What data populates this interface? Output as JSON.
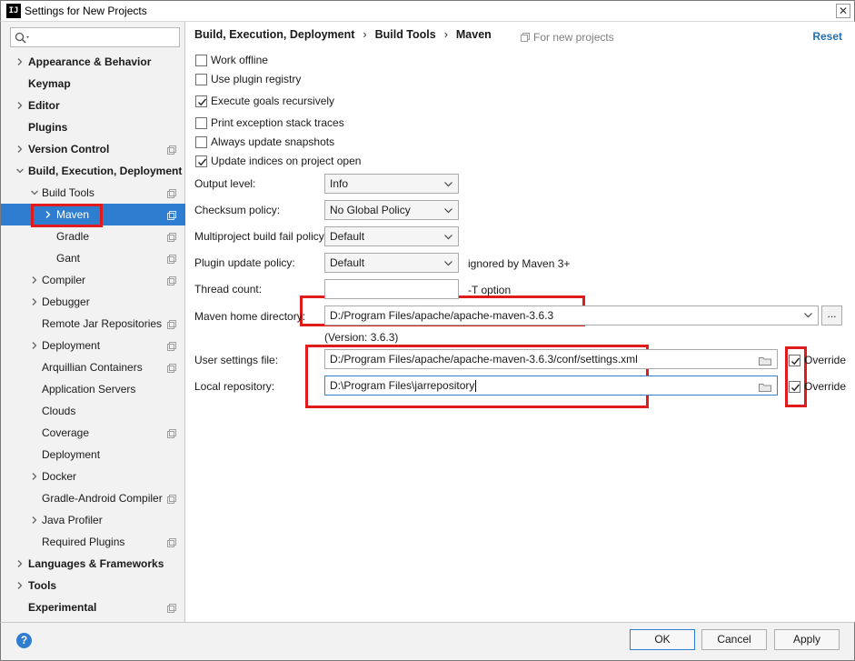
{
  "window": {
    "title": "Settings for New Projects",
    "logo": "IJ",
    "close_glyph": "✕"
  },
  "search": {
    "placeholder": "",
    "value": ""
  },
  "sidebar": {
    "items": [
      {
        "label": "Appearance & Behavior",
        "bold": true,
        "arrow": "right",
        "level": 0,
        "cfg": false
      },
      {
        "label": "Keymap",
        "bold": true,
        "arrow": "none",
        "level": 0,
        "cfg": false
      },
      {
        "label": "Editor",
        "bold": true,
        "arrow": "right",
        "level": 0,
        "cfg": false
      },
      {
        "label": "Plugins",
        "bold": true,
        "arrow": "none",
        "level": 0,
        "cfg": false
      },
      {
        "label": "Version Control",
        "bold": true,
        "arrow": "right",
        "level": 0,
        "cfg": true
      },
      {
        "label": "Build, Execution, Deployment",
        "bold": true,
        "arrow": "down",
        "level": 0,
        "cfg": false
      },
      {
        "label": "Build Tools",
        "bold": false,
        "arrow": "down",
        "level": 1,
        "cfg": true
      },
      {
        "label": "Maven",
        "bold": false,
        "arrow": "right",
        "level": 2,
        "cfg": true,
        "selected": true
      },
      {
        "label": "Gradle",
        "bold": false,
        "arrow": "none",
        "level": 2,
        "cfg": true
      },
      {
        "label": "Gant",
        "bold": false,
        "arrow": "none",
        "level": 2,
        "cfg": true
      },
      {
        "label": "Compiler",
        "bold": false,
        "arrow": "right",
        "level": 1,
        "cfg": true
      },
      {
        "label": "Debugger",
        "bold": false,
        "arrow": "right",
        "level": 1,
        "cfg": false
      },
      {
        "label": "Remote Jar Repositories",
        "bold": false,
        "arrow": "none",
        "level": 1,
        "cfg": true
      },
      {
        "label": "Deployment",
        "bold": false,
        "arrow": "right",
        "level": 1,
        "cfg": true
      },
      {
        "label": "Arquillian Containers",
        "bold": false,
        "arrow": "none",
        "level": 1,
        "cfg": true
      },
      {
        "label": "Application Servers",
        "bold": false,
        "arrow": "none",
        "level": 1,
        "cfg": false
      },
      {
        "label": "Clouds",
        "bold": false,
        "arrow": "none",
        "level": 1,
        "cfg": false
      },
      {
        "label": "Coverage",
        "bold": false,
        "arrow": "none",
        "level": 1,
        "cfg": true
      },
      {
        "label": "Deployment",
        "bold": false,
        "arrow": "none",
        "level": 1,
        "cfg": false
      },
      {
        "label": "Docker",
        "bold": false,
        "arrow": "right",
        "level": 1,
        "cfg": false
      },
      {
        "label": "Gradle-Android Compiler",
        "bold": false,
        "arrow": "none",
        "level": 1,
        "cfg": true
      },
      {
        "label": "Java Profiler",
        "bold": false,
        "arrow": "right",
        "level": 1,
        "cfg": false
      },
      {
        "label": "Required Plugins",
        "bold": false,
        "arrow": "none",
        "level": 1,
        "cfg": true
      },
      {
        "label": "Languages & Frameworks",
        "bold": true,
        "arrow": "right",
        "level": 0,
        "cfg": false
      },
      {
        "label": "Tools",
        "bold": true,
        "arrow": "right",
        "level": 0,
        "cfg": false
      },
      {
        "label": "Experimental",
        "bold": true,
        "arrow": "none",
        "level": 0,
        "cfg": true
      }
    ]
  },
  "header": {
    "breadcrumb": [
      "Build, Execution, Deployment",
      "Build Tools",
      "Maven"
    ],
    "separator": "›",
    "scope_hint": "For new projects",
    "reset_label": "Reset"
  },
  "options": [
    {
      "label": "Work offline",
      "checked": false
    },
    {
      "label": "Use plugin registry",
      "checked": false
    },
    {
      "label": "Execute goals recursively",
      "checked": true
    },
    {
      "label": "Print exception stack traces",
      "checked": false
    },
    {
      "label": "Always update snapshots",
      "checked": false
    },
    {
      "label": "Update indices on project open",
      "checked": true
    }
  ],
  "form": {
    "output_level": {
      "label": "Output level:",
      "value": "Info"
    },
    "checksum_policy": {
      "label": "Checksum policy:",
      "value": "No Global Policy"
    },
    "multiproject_policy": {
      "label": "Multiproject build fail policy:",
      "value": "Default"
    },
    "plugin_update_policy": {
      "label": "Plugin update policy:",
      "value": "Default",
      "hint": "ignored by Maven 3+"
    },
    "thread_count": {
      "label": "Thread count:",
      "value": "",
      "hint": "-T option"
    },
    "maven_home": {
      "label": "Maven home directory:",
      "value": "D:/Program Files/apache/apache-maven-3.6.3",
      "version": "(Version: 3.6.3)",
      "browse_label": "..."
    },
    "user_settings": {
      "label": "User settings file:",
      "value": "D:/Program Files/apache/apache-maven-3.6.3/conf/settings.xml",
      "override_label": "Override",
      "override_checked": true
    },
    "local_repo": {
      "label": "Local repository:",
      "value": "D:\\Program Files\\jarrepository",
      "override_label": "Override",
      "override_checked": true
    }
  },
  "footer": {
    "help_glyph": "?",
    "ok_label": "OK",
    "cancel_label": "Cancel",
    "apply_label": "Apply"
  },
  "colors": {
    "selection": "#2f7dd1",
    "highlight_box": "#e01b1b",
    "link": "#2470b3"
  }
}
